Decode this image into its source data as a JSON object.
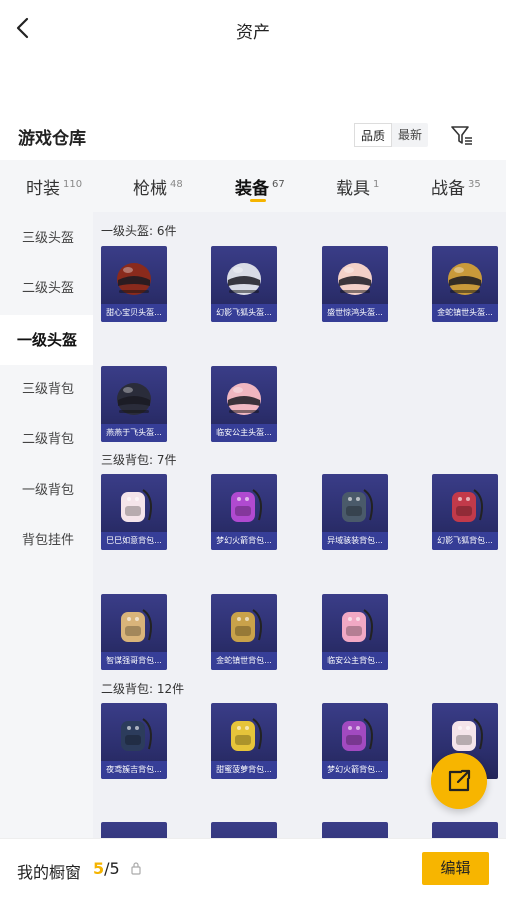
{
  "nav": {
    "title": "资产"
  },
  "section": {
    "title": "游戏仓库",
    "sort_options": [
      "品质",
      "最新"
    ],
    "active_sort": "品质"
  },
  "tabs": [
    {
      "label": "时装",
      "count": "110"
    },
    {
      "label": "枪械",
      "count": "48"
    },
    {
      "label": "装备",
      "count": "67"
    },
    {
      "label": "载具",
      "count": "1"
    },
    {
      "label": "战备",
      "count": "35"
    }
  ],
  "sidebar": {
    "items": [
      {
        "label": "三级头盔"
      },
      {
        "label": "二级头盔"
      },
      {
        "label": "一级头盔"
      },
      {
        "label": "三级背包"
      },
      {
        "label": "二级背包"
      },
      {
        "label": "一级背包"
      },
      {
        "label": "背包挂件"
      }
    ],
    "active": "一级头盔"
  },
  "groups": [
    {
      "title": "一级头盔: 6件",
      "items": [
        {
          "name": "甜心宝贝头盔...",
          "icon": "helmet",
          "color": "#8a2a1c"
        },
        {
          "name": "幻影飞狐头盔...",
          "icon": "helmet",
          "color": "#d9dce6"
        },
        {
          "name": "盛世惊鸿头盔...",
          "icon": "helmet",
          "color": "#f3d1c8"
        },
        {
          "name": "金蛇镇世头盔...",
          "icon": "helmet",
          "color": "#c99a3a"
        },
        {
          "name": "燕燕于飞头盔...",
          "icon": "helmet",
          "color": "#2a2c3a"
        },
        {
          "name": "临安公主头盔...",
          "icon": "helmet",
          "color": "#f0b6c0"
        }
      ]
    },
    {
      "title": "三级背包: 7件",
      "items": [
        {
          "name": "巳巳如意背包...",
          "icon": "backpack",
          "color": "#f4e4ea"
        },
        {
          "name": "梦幻火箭背包...",
          "icon": "backpack",
          "color": "#b04ad0"
        },
        {
          "name": "异域骇装背包...",
          "icon": "backpack",
          "color": "#4a5a6a"
        },
        {
          "name": "幻影飞狐背包...",
          "icon": "backpack",
          "color": "#c23a4a"
        },
        {
          "name": "智谋强哥背包...",
          "icon": "backpack",
          "color": "#d9b47a"
        },
        {
          "name": "金蛇镇世背包...",
          "icon": "backpack",
          "color": "#c9a24a"
        },
        {
          "name": "临安公主背包...",
          "icon": "backpack",
          "color": "#f1a8c4"
        }
      ]
    },
    {
      "title": "二级背包: 12件",
      "items": [
        {
          "name": "夜鸢簇吉背包...",
          "icon": "backpack",
          "color": "#2c3c5c"
        },
        {
          "name": "甜蜜菠萝背包...",
          "icon": "backpack",
          "color": "#e6c43a"
        },
        {
          "name": "梦幻火箭背包...",
          "icon": "backpack",
          "color": "#a24ac0"
        },
        {
          "name": "",
          "icon": "backpack",
          "color": "#f4e4ea"
        }
      ]
    }
  ],
  "bottom": {
    "label": "我的橱窗",
    "current": "5",
    "total": "/5",
    "edit_label": "编辑"
  },
  "colors": {
    "accent": "#f7b500",
    "card_bg": "#2c2f6e"
  }
}
